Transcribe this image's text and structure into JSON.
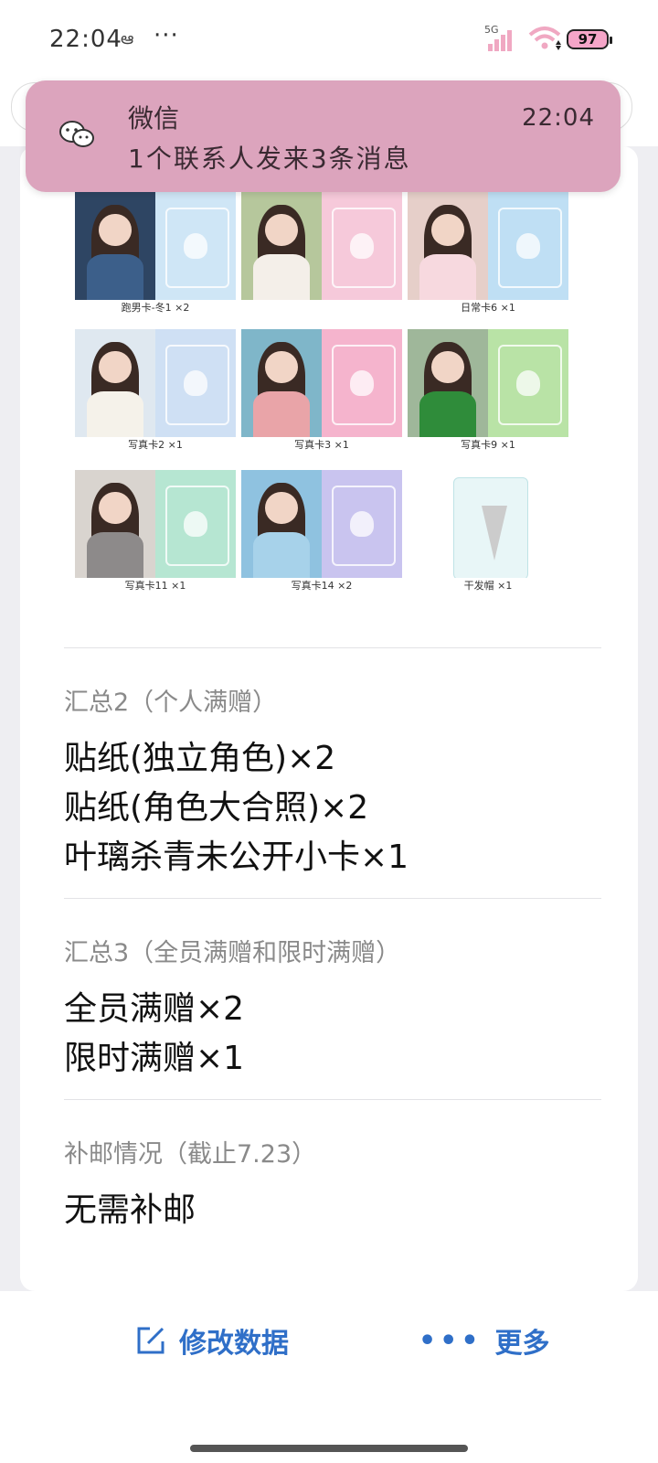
{
  "status_bar": {
    "time": "22:04",
    "dots": "···",
    "network": "5G",
    "battery": "97"
  },
  "notification": {
    "app": "微信",
    "time": "22:04",
    "message": "1个联系人发来3条消息"
  },
  "products": [
    {
      "caption": "跑男卡-冬1 ×2",
      "photo_color": "#2e4563",
      "design_color": "#cfe6f6"
    },
    {
      "caption": "",
      "photo_color": "#6b8f3c",
      "design_color": "#f6c9da"
    },
    {
      "caption": "日常卡6 ×1",
      "photo_color": "#e6cfc9",
      "design_color": "#bfdff4"
    },
    {
      "caption": "写真卡2 ×1",
      "photo_color": "#dfe8f0",
      "design_color": "#cfe0f4"
    },
    {
      "caption": "写真卡3 ×1",
      "photo_color": "#7fb6c9",
      "design_color": "#f5b4cd"
    },
    {
      "caption": "写真卡9 ×1",
      "photo_color": "#2f8c3a",
      "design_color": "#b9e3a6"
    },
    {
      "caption": "写真卡11 ×1",
      "photo_color": "#8d8a8a",
      "design_color": "#b6e6d2"
    },
    {
      "caption": "写真卡14 ×2",
      "photo_color": "#8fc2e0",
      "design_color": "#c9c4ef"
    },
    {
      "caption": "干发帽 ×1",
      "photo_color": "#e8f6f7",
      "design_color": "#e8f6f7"
    }
  ],
  "summary2": {
    "title": "汇总2（个人满赠）",
    "lines": [
      "贴纸(独立角色)×2",
      "贴纸(角色大合照)×2",
      "叶璃杀青未公开小卡×1"
    ]
  },
  "summary3": {
    "title": "汇总3（全员满赠和限时满赠）",
    "lines": [
      "全员满赠×2",
      "限时满赠×1"
    ]
  },
  "shipping": {
    "title": "补邮情况（截止7.23）",
    "value": "无需补邮"
  },
  "bottom_bar": {
    "edit_label": "修改数据",
    "more_label": "更多"
  }
}
